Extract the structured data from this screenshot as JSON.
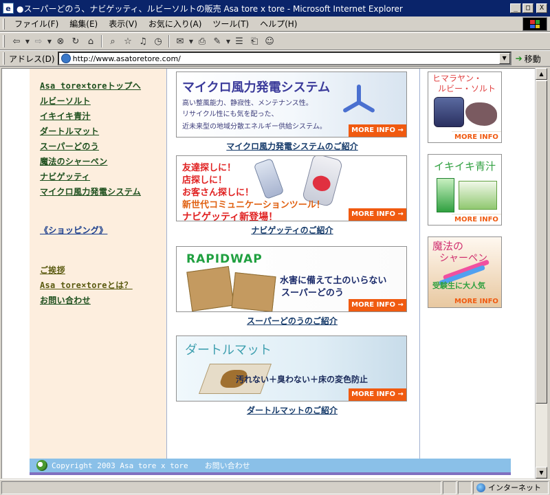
{
  "window": {
    "title": "●スーパーどのう、ナビゲッティ、ルビーソルトの販売  Asa tore x tore - Microsoft Internet Explorer",
    "buttons": [
      "_",
      "□",
      "X"
    ]
  },
  "menubar": {
    "items": [
      "ファイル(F)",
      "編集(E)",
      "表示(V)",
      "お気に入り(A)",
      "ツール(T)",
      "ヘルプ(H)"
    ]
  },
  "addressbar": {
    "label": "アドレス(D)",
    "url": "http://www.asatoretore.com/",
    "go_label": "移動"
  },
  "leftnav": {
    "main_links": [
      "Asa tore×toreトップへ",
      "ルビーソルト",
      "イキイキ青汁",
      "ダートルマット",
      "スーパーどのう",
      "魔法のシャーペン",
      "ナビゲッティ",
      "マイクロ風力発電システム"
    ],
    "shopping_link": "《ショッピング》",
    "info_links": [
      "ご挨拶",
      "Asa tore×toreとは？",
      "お問い合わせ"
    ]
  },
  "banners": [
    {
      "headline": "マイクロ風力発電システム",
      "lines": [
        "高い整風能力、静寂性、メンテナンス性。",
        "リサイクル性にも気を配った、",
        "近未来型の地域分散エネルギー供給システム。"
      ],
      "more": "MORE INFO →",
      "caption": "マイクロ風力発電システムのご紹介"
    },
    {
      "lines": [
        "友達探しに！",
        "店探しに！",
        "お客さん探しに！",
        "新世代コミュニケーションツール！",
        "ナビゲッティ新登場！"
      ],
      "more": "MORE INFO →",
      "caption": "ナビゲッティのご紹介"
    },
    {
      "logo": "RAPIDWAP",
      "lines": [
        "水害に備えて土のいらない",
        "スーパーどのう"
      ],
      "more": "MORE INFO →",
      "caption": "スーパーどのうのご紹介"
    },
    {
      "headline": "ダートルマット",
      "lines": [
        "汚れない＋臭わない＋床の変色防止"
      ],
      "more": "MORE INFO →",
      "caption": "ダートルマットのご紹介"
    }
  ],
  "side_ads": [
    {
      "title_lines": [
        "ヒマラヤン・",
        "ルビー・ソルト"
      ],
      "more": "MORE INFO →"
    },
    {
      "title": "イキイキ青汁",
      "more": "MORE INFO →"
    },
    {
      "title_lines": [
        "魔法の",
        "シャーペン"
      ],
      "tagline": "受験生に大人気",
      "more": "MORE INFO →"
    }
  ],
  "footer": {
    "copyright": "Copyright 2003 Asa tore x tore",
    "contact": "お問い合わせ"
  },
  "statusbar": {
    "zone": "インターネット"
  },
  "colors": {
    "titlebar": "#0a246a",
    "nav_bg": "#fdeede",
    "footer_bg": "#8ac0e8",
    "more_info": "#f05a10"
  }
}
